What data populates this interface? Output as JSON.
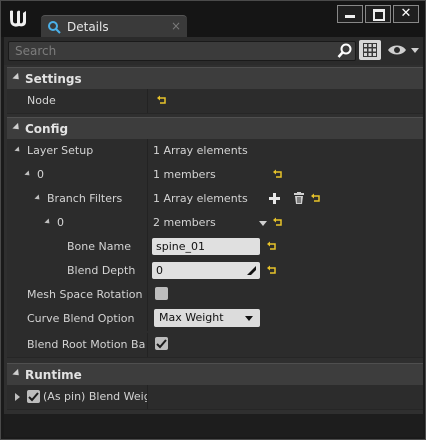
{
  "window": {
    "tab_label": "Details",
    "tab_close": "×",
    "close_glyph": "✕"
  },
  "toolbar": {
    "search_placeholder": "Search"
  },
  "sections": {
    "settings": "Settings",
    "config": "Config",
    "runtime": "Runtime"
  },
  "rows": {
    "node": {
      "label": "Node"
    },
    "layer_setup": {
      "label": "Layer Setup",
      "value": "1 Array elements"
    },
    "layer_0": {
      "label": "0",
      "value": "1 members"
    },
    "branch_filters": {
      "label": "Branch Filters",
      "value": "1 Array elements"
    },
    "branch_0": {
      "label": "0",
      "value": "2 members"
    },
    "bone_name": {
      "label": "Bone Name",
      "value": "spine_01"
    },
    "blend_depth": {
      "label": "Blend Depth",
      "value": "0"
    },
    "mesh_space": {
      "label": "Mesh Space Rotation Bl"
    },
    "curve_blend": {
      "label": "Curve Blend Option",
      "value": "Max Weight"
    },
    "blend_root": {
      "label": "Blend Root Motion Base"
    },
    "blend_weights": {
      "label": "(As pin) Blend Weigh"
    }
  },
  "colors": {
    "accent_yellow": "#e8c32a",
    "panel_bg": "#2f2f2f",
    "header_bg": "#3d3d3d"
  }
}
